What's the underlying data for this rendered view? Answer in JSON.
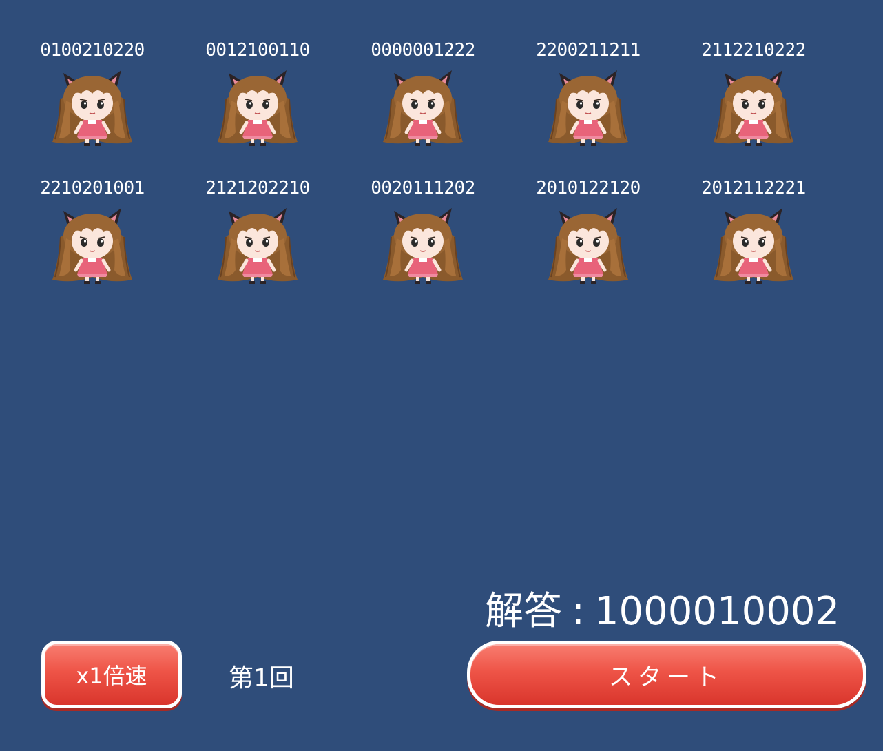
{
  "characters": [
    {
      "code": "0100210220"
    },
    {
      "code": "0012100110"
    },
    {
      "code": "0000001222"
    },
    {
      "code": "2200211211"
    },
    {
      "code": "2112210222"
    },
    {
      "code": "2210201001"
    },
    {
      "code": "2121202210"
    },
    {
      "code": "0020111202"
    },
    {
      "code": "2010122120"
    },
    {
      "code": "2012112221"
    }
  ],
  "answer": {
    "label": "解答",
    "separator": ":",
    "value": "1000010002"
  },
  "controls": {
    "speed_label": "x1倍速",
    "round_label": "第1回",
    "start_label": "スタート"
  },
  "colors": {
    "background": "#2f4d7a",
    "button": "#ee5447"
  },
  "sprite_icon": "cat-eared-girl-icon"
}
